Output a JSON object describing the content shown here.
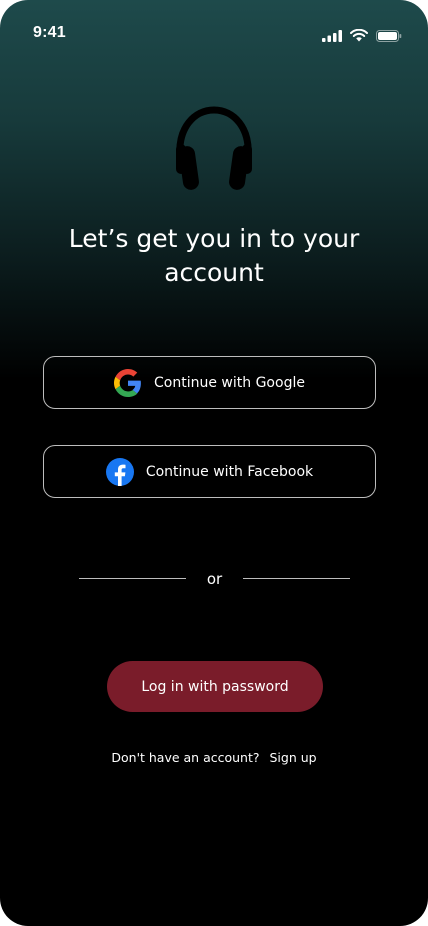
{
  "status_bar": {
    "time": "9:41",
    "icons": [
      "signal-icon",
      "wifi-icon",
      "battery-icon"
    ]
  },
  "hero": {
    "icon": "headphones-icon",
    "title_line1": "Let’s get you in to your",
    "title_line2": "account"
  },
  "auth": {
    "google_label": "Continue with Google",
    "facebook_label": "Continue with Facebook",
    "divider_text": "or",
    "password_label": "Log in with password"
  },
  "footer": {
    "prompt": "Don't have an account?",
    "signup_link": "Sign up"
  },
  "colors": {
    "accent": "#7a1c2a",
    "gradient_top": "#1e4a4b",
    "background": "#000000",
    "border": "#bdbdbd",
    "facebook_blue": "#1877f2"
  }
}
